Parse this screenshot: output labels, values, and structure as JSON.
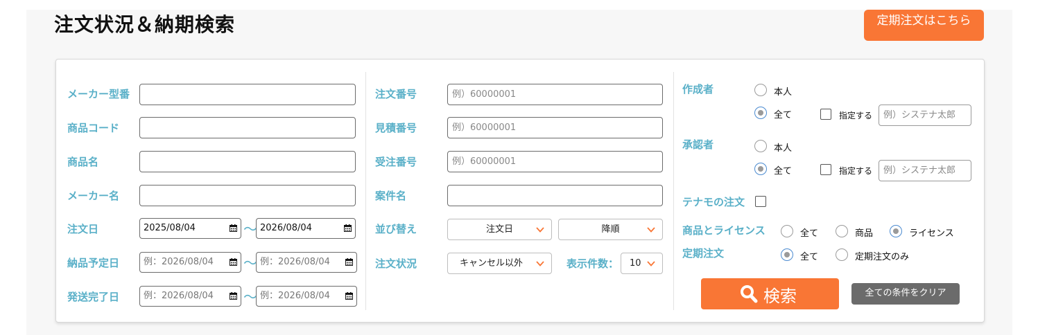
{
  "page_title": "注文状況＆納期検索",
  "regular_order_button": "定期注文はこちら",
  "col1": {
    "maker_model_label": "メーカー型番",
    "product_code_label": "商品コード",
    "product_name_label": "商品名",
    "maker_name_label": "メーカー名",
    "order_date_label": "注文日",
    "order_date_from": "2025/08/04",
    "order_date_to": "2026/08/04",
    "delivery_date_label": "納品予定日",
    "delivery_from_placeholder": "例：2026/08/04",
    "delivery_to_placeholder": "例：2026/08/04",
    "shipping_date_label": "発送完了日",
    "shipping_from_placeholder": "例：2026/08/04",
    "shipping_to_placeholder": "例：2026/08/04",
    "tilde": "～"
  },
  "col2": {
    "order_number_label": "注文番号",
    "order_number_placeholder": "例）60000001",
    "quote_number_label": "見積番号",
    "quote_number_placeholder": "例）60000001",
    "received_number_label": "受注番号",
    "received_number_placeholder": "例）60000001",
    "project_name_label": "案件名",
    "sort_label": "並び替え",
    "sort_field": "注文日",
    "sort_order": "降順",
    "order_status_label": "注文状況",
    "order_status": "キャンセル以外",
    "display_count_label": "表示件数：",
    "display_count": "10"
  },
  "col3": {
    "creator_label": "作成者",
    "creator_self": "本人",
    "creator_all": "全て",
    "creator_specify": "指定する",
    "creator_placeholder": "例）システナ太郎",
    "approver_label": "承認者",
    "approver_self": "本人",
    "approver_all": "全て",
    "approver_specify": "指定する",
    "approver_placeholder": "例）システナ太郎",
    "tenamo_label": "テナモの注文",
    "product_license_label": "商品とライセンス",
    "pl_all": "全て",
    "pl_product": "商品",
    "pl_license": "ライセンス",
    "regular_label": "定期注文",
    "regular_all": "全て",
    "regular_only": "定期注文のみ"
  },
  "actions": {
    "search_label": "検索",
    "clear_label": "全ての条件をクリア"
  },
  "colors": {
    "accent": "#f97635",
    "label": "#5ab0c8",
    "clear_button": "#6b6b6b"
  }
}
